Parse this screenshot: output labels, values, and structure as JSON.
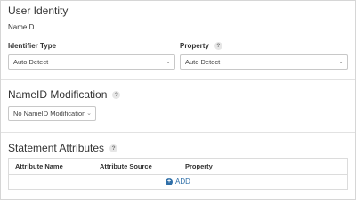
{
  "user_identity": {
    "title": "User Identity",
    "name_id_label": "NameID",
    "identifier_type": {
      "label": "Identifier Type",
      "value": "Auto Detect"
    },
    "property": {
      "label": "Property",
      "value": "Auto Detect",
      "help": "?"
    }
  },
  "nameid_modification": {
    "title": "NameID Modification",
    "help": "?",
    "value": "No NameID Modification"
  },
  "statement_attributes": {
    "title": "Statement Attributes",
    "help": "?",
    "columns": [
      "Attribute Name",
      "Attribute Source",
      "Property"
    ],
    "add_label": "ADD",
    "add_icon": "plus-circle-icon"
  },
  "icons": {
    "chevron": "⌄",
    "plus": "+"
  },
  "colors": {
    "accent": "#2f6fa8",
    "border": "#c8c8c8"
  }
}
